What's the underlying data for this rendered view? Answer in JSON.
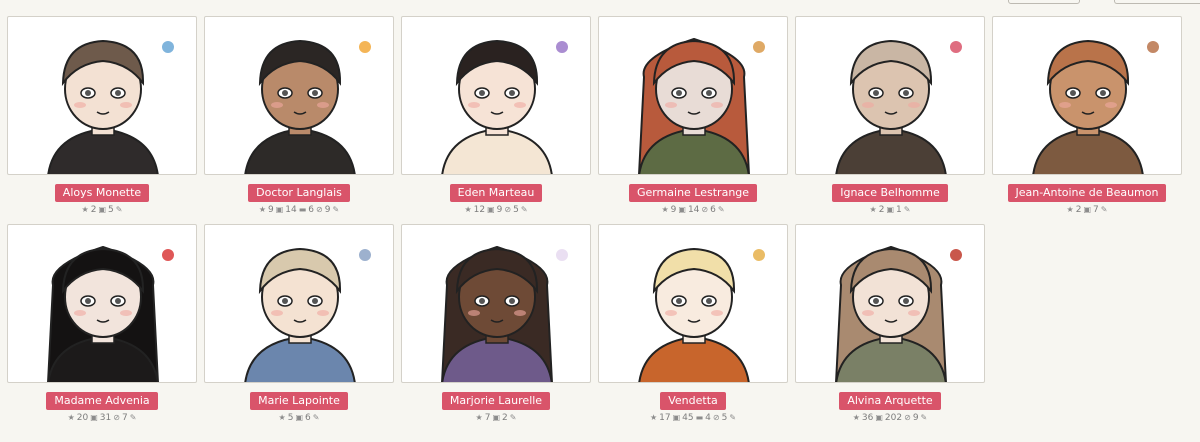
{
  "top_buttons": [
    "",
    ""
  ],
  "characters": [
    {
      "name": "Aloys Monette",
      "stats": [
        {
          "icon": "star-icon",
          "value": "2"
        },
        {
          "icon": "image-icon",
          "value": "5"
        },
        {
          "icon": "pencil-icon",
          "value": ""
        }
      ],
      "palette": {
        "hair": "#6e5a4b",
        "skin": "#f3e1d3",
        "cloth": "#2f2b2b",
        "accent": "#6aa7d6"
      }
    },
    {
      "name": "Doctor Langlais",
      "stats": [
        {
          "icon": "star-icon",
          "value": "9"
        },
        {
          "icon": "image-icon",
          "value": "14"
        },
        {
          "icon": "comment-icon",
          "value": "6"
        },
        {
          "icon": "link-icon",
          "value": "9"
        },
        {
          "icon": "pencil-icon",
          "value": ""
        }
      ],
      "palette": {
        "hair": "#2b2624",
        "skin": "#b98a6a",
        "cloth": "#2d2a28",
        "accent": "#f2a83a"
      }
    },
    {
      "name": "Eden Marteau",
      "stats": [
        {
          "icon": "star-icon",
          "value": "12"
        },
        {
          "icon": "image-icon",
          "value": "9"
        },
        {
          "icon": "link-icon",
          "value": "5"
        },
        {
          "icon": "pencil-icon",
          "value": ""
        }
      ],
      "palette": {
        "hair": "#2a2220",
        "skin": "#f6e3d6",
        "cloth": "#f4e6d4",
        "accent": "#9b79c9"
      }
    },
    {
      "name": "Germaine Lestrange",
      "stats": [
        {
          "icon": "star-icon",
          "value": "9"
        },
        {
          "icon": "image-icon",
          "value": "14"
        },
        {
          "icon": "link-icon",
          "value": "6"
        },
        {
          "icon": "pencil-icon",
          "value": ""
        }
      ],
      "palette": {
        "hair": "#b85a3c",
        "skin": "#e8dcd6",
        "cloth": "#5d6b44",
        "accent": "#d99a4a"
      }
    },
    {
      "name": "Ignace Belhomme",
      "stats": [
        {
          "icon": "star-icon",
          "value": "2"
        },
        {
          "icon": "image-icon",
          "value": "1"
        },
        {
          "icon": "pencil-icon",
          "value": ""
        }
      ],
      "palette": {
        "hair": "#c9b6a4",
        "skin": "#dcc4b0",
        "cloth": "#4b3f36",
        "accent": "#d9546a"
      }
    },
    {
      "name": "Jean-Antoine de Beaumon",
      "stats": [
        {
          "icon": "star-icon",
          "value": "2"
        },
        {
          "icon": "image-icon",
          "value": "7"
        },
        {
          "icon": "pencil-icon",
          "value": ""
        }
      ],
      "palette": {
        "hair": "#b9734a",
        "skin": "#c9936c",
        "cloth": "#7d5a40",
        "accent": "#b9734a"
      }
    },
    {
      "name": "Madame Advenia",
      "stats": [
        {
          "icon": "star-icon",
          "value": "20"
        },
        {
          "icon": "image-icon",
          "value": "31"
        },
        {
          "icon": "link-icon",
          "value": "7"
        },
        {
          "icon": "pencil-icon",
          "value": ""
        }
      ],
      "palette": {
        "hair": "#141212",
        "skin": "#f2e4dc",
        "cloth": "#1c1a1a",
        "accent": "#d93a3a"
      }
    },
    {
      "name": "Marie Lapointe",
      "stats": [
        {
          "icon": "star-icon",
          "value": "5"
        },
        {
          "icon": "image-icon",
          "value": "6"
        },
        {
          "icon": "pencil-icon",
          "value": ""
        }
      ],
      "palette": {
        "hair": "#d8c9ad",
        "skin": "#f4e2d2",
        "cloth": "#6b86ad",
        "accent": "#8ca3c6"
      }
    },
    {
      "name": "Marjorie Laurelle",
      "stats": [
        {
          "icon": "star-icon",
          "value": "7"
        },
        {
          "icon": "image-icon",
          "value": "2"
        },
        {
          "icon": "pencil-icon",
          "value": ""
        }
      ],
      "palette": {
        "hair": "#3a2a24",
        "skin": "#6e4a36",
        "cloth": "#6e5a8a",
        "accent": "#e6d9f0"
      }
    },
    {
      "name": "Vendetta",
      "stats": [
        {
          "icon": "star-icon",
          "value": "17"
        },
        {
          "icon": "image-icon",
          "value": "45"
        },
        {
          "icon": "comment-icon",
          "value": "4"
        },
        {
          "icon": "link-icon",
          "value": "5"
        },
        {
          "icon": "pencil-icon",
          "value": ""
        }
      ],
      "palette": {
        "hair": "#f1dfa9",
        "skin": "#f8ebdf",
        "cloth": "#c8652c",
        "accent": "#e6b04a"
      }
    },
    {
      "name": "Alvina Arquette",
      "stats": [
        {
          "icon": "star-icon",
          "value": "36"
        },
        {
          "icon": "image-icon",
          "value": "202"
        },
        {
          "icon": "link-icon",
          "value": "9"
        },
        {
          "icon": "pencil-icon",
          "value": ""
        }
      ],
      "palette": {
        "hair": "#a98a70",
        "skin": "#f2e2d6",
        "cloth": "#7a8066",
        "accent": "#c0392b"
      }
    }
  ]
}
